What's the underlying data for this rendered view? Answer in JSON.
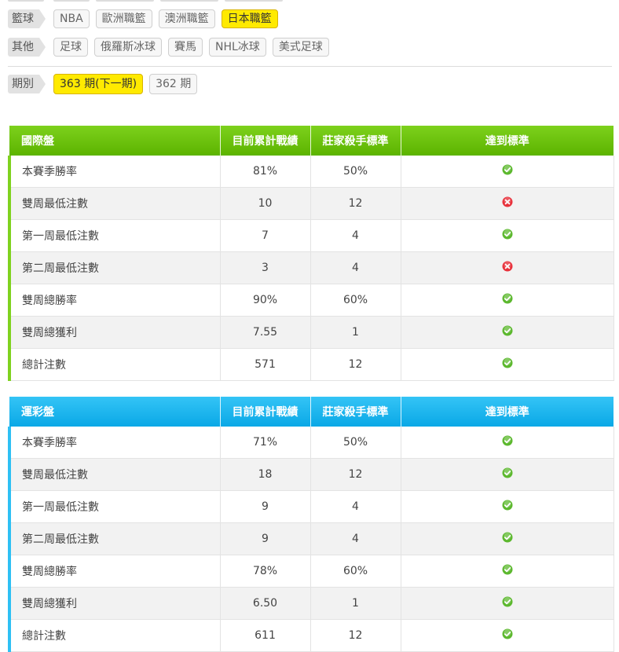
{
  "filters": {
    "basketball": {
      "label": "籃球",
      "chips": [
        {
          "text": "NBA",
          "active": false
        },
        {
          "text": "歐洲職籃",
          "active": false
        },
        {
          "text": "澳洲職籃",
          "active": false
        },
        {
          "text": "日本職籃",
          "active": true
        }
      ]
    },
    "other": {
      "label": "其他",
      "chips": [
        {
          "text": "足球",
          "active": false
        },
        {
          "text": "俄羅斯冰球",
          "active": false
        },
        {
          "text": "賽馬",
          "active": false
        },
        {
          "text": "NHL冰球",
          "active": false
        },
        {
          "text": "美式足球",
          "active": false
        }
      ]
    },
    "period": {
      "label": "期別",
      "chips": [
        {
          "text": "363 期(下一期)",
          "active": true
        },
        {
          "text": "362 期",
          "active": false
        }
      ]
    }
  },
  "colors": {
    "green_header": "#6cc40a",
    "blue_header": "#1bb3ee",
    "active_chip": "#ffea00",
    "pass_icon": "#5cb82e",
    "fail_icon": "#e8313b"
  },
  "tables": {
    "international": {
      "headers": [
        "國際盤",
        "目前累計戰績",
        "莊家殺手標準",
        "達到標準"
      ],
      "rows": [
        {
          "label": "本賽季勝率",
          "current": "81%",
          "standard": "50%",
          "status": "pass"
        },
        {
          "label": "雙周最低注數",
          "current": "10",
          "standard": "12",
          "status": "fail"
        },
        {
          "label": "第一周最低注數",
          "current": "7",
          "standard": "4",
          "status": "pass"
        },
        {
          "label": "第二周最低注數",
          "current": "3",
          "standard": "4",
          "status": "fail"
        },
        {
          "label": "雙周總勝率",
          "current": "90%",
          "standard": "60%",
          "status": "pass"
        },
        {
          "label": "雙周總獲利",
          "current": "7.55",
          "standard": "1",
          "status": "pass"
        },
        {
          "label": "總計注數",
          "current": "571",
          "standard": "12",
          "status": "pass"
        }
      ]
    },
    "lottery": {
      "headers": [
        "運彩盤",
        "目前累計戰績",
        "莊家殺手標準",
        "達到標準"
      ],
      "rows": [
        {
          "label": "本賽季勝率",
          "current": "71%",
          "standard": "50%",
          "status": "pass"
        },
        {
          "label": "雙周最低注數",
          "current": "18",
          "standard": "12",
          "status": "pass"
        },
        {
          "label": "第一周最低注數",
          "current": "9",
          "standard": "4",
          "status": "pass"
        },
        {
          "label": "第二周最低注數",
          "current": "9",
          "standard": "4",
          "status": "pass"
        },
        {
          "label": "雙周總勝率",
          "current": "78%",
          "standard": "60%",
          "status": "pass"
        },
        {
          "label": "雙周總獲利",
          "current": "6.50",
          "standard": "1",
          "status": "pass"
        },
        {
          "label": "總計注數",
          "current": "611",
          "standard": "12",
          "status": "pass"
        }
      ]
    }
  }
}
